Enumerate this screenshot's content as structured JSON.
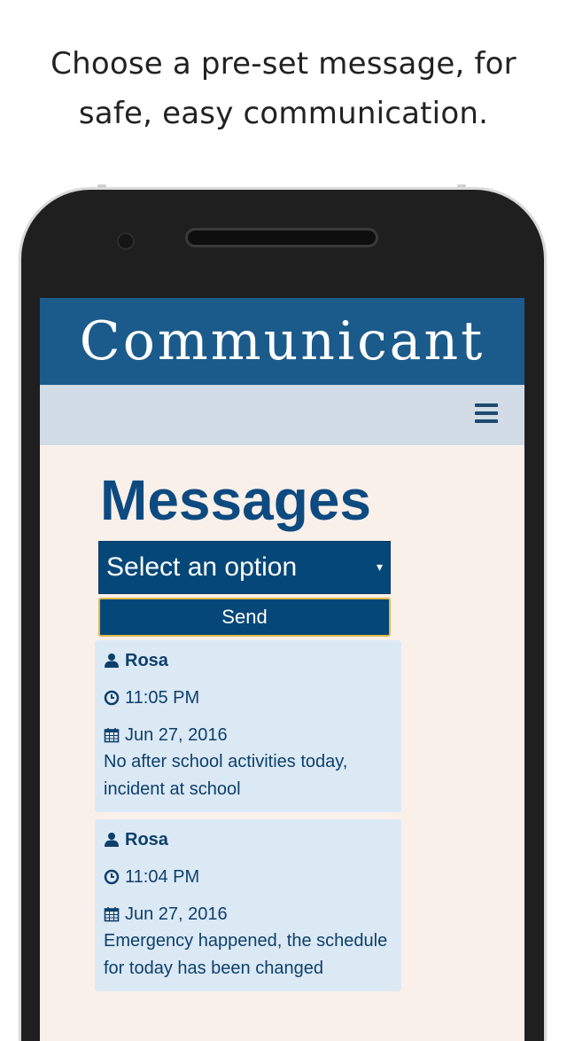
{
  "promo": {
    "line1": "Choose a pre-set message, for",
    "line2": "safe, easy communication."
  },
  "app": {
    "title": "Communicant"
  },
  "navbar": {
    "menu_icon": "hamburger-menu-icon"
  },
  "page": {
    "title": "Messages"
  },
  "form": {
    "select_value": "Select an option",
    "send_label": "Send"
  },
  "messages": [
    {
      "sender": "Rosa",
      "time": "11:05 PM",
      "date": "Jun 27, 2016",
      "text": "No after school activities today, incident at school"
    },
    {
      "sender": "Rosa",
      "time": "11:04 PM",
      "date": "Jun 27, 2016",
      "text": "Emergency happened, the schedule for today has been changed"
    }
  ],
  "colors": {
    "header": "#1b5b8b",
    "navbar": "#d1dce6",
    "screen_bg": "#faf0ea",
    "primary": "#064779",
    "button_border": "#e0b84a",
    "card_bg": "#dbe9f5"
  }
}
